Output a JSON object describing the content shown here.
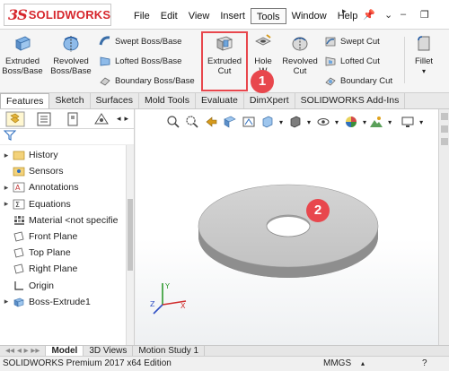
{
  "app": {
    "logo_prefix": "3S",
    "logo_text": "SOLIDWORKS"
  },
  "menu": {
    "items": [
      "File",
      "Edit",
      "View",
      "Insert",
      "Tools",
      "Window",
      "Help"
    ],
    "active": "Tools"
  },
  "ribbon": {
    "extruded_boss": [
      "Extruded",
      "Boss/Base"
    ],
    "revolved_boss": [
      "Revolved",
      "Boss/Base"
    ],
    "swept_boss": "Swept Boss/Base",
    "lofted_boss": "Lofted Boss/Base",
    "boundary_boss": "Boundary Boss/Base",
    "extruded_cut": [
      "Extruded",
      "Cut"
    ],
    "hole_wizard": [
      "Hole",
      "W"
    ],
    "revolved_cut": [
      "Revolved",
      "Cut"
    ],
    "swept_cut": "Swept Cut",
    "lofted_cut": "Lofted Cut",
    "boundary_cut": "Boundary Cut",
    "fillet": "Fillet"
  },
  "callouts": {
    "step1": "1",
    "step2": "2"
  },
  "tabs": [
    "Features",
    "Sketch",
    "Surfaces",
    "Mold Tools",
    "Evaluate",
    "DimXpert",
    "SOLIDWORKS Add-Ins"
  ],
  "active_tab": "Features",
  "tree": [
    {
      "label": "History",
      "expandable": true
    },
    {
      "label": "Sensors",
      "expandable": false
    },
    {
      "label": "Annotations",
      "expandable": true
    },
    {
      "label": "Equations",
      "expandable": true
    },
    {
      "label": "Material <not specifie",
      "expandable": false
    },
    {
      "label": "Front Plane",
      "expandable": false
    },
    {
      "label": "Top Plane",
      "expandable": false
    },
    {
      "label": "Right Plane",
      "expandable": false
    },
    {
      "label": "Origin",
      "expandable": false
    },
    {
      "label": "Boss-Extrude1",
      "expandable": true
    }
  ],
  "bottom_tabs": [
    "Model",
    "3D Views",
    "Motion Study 1"
  ],
  "active_bottom_tab": "Model",
  "status": {
    "text": "SOLIDWORKS Premium 2017 x64 Edition",
    "units": "MMGS"
  },
  "colors": {
    "accent_red": "#e8474d",
    "brand_red": "#d6262c",
    "part_gray": "#c9c9c9"
  }
}
